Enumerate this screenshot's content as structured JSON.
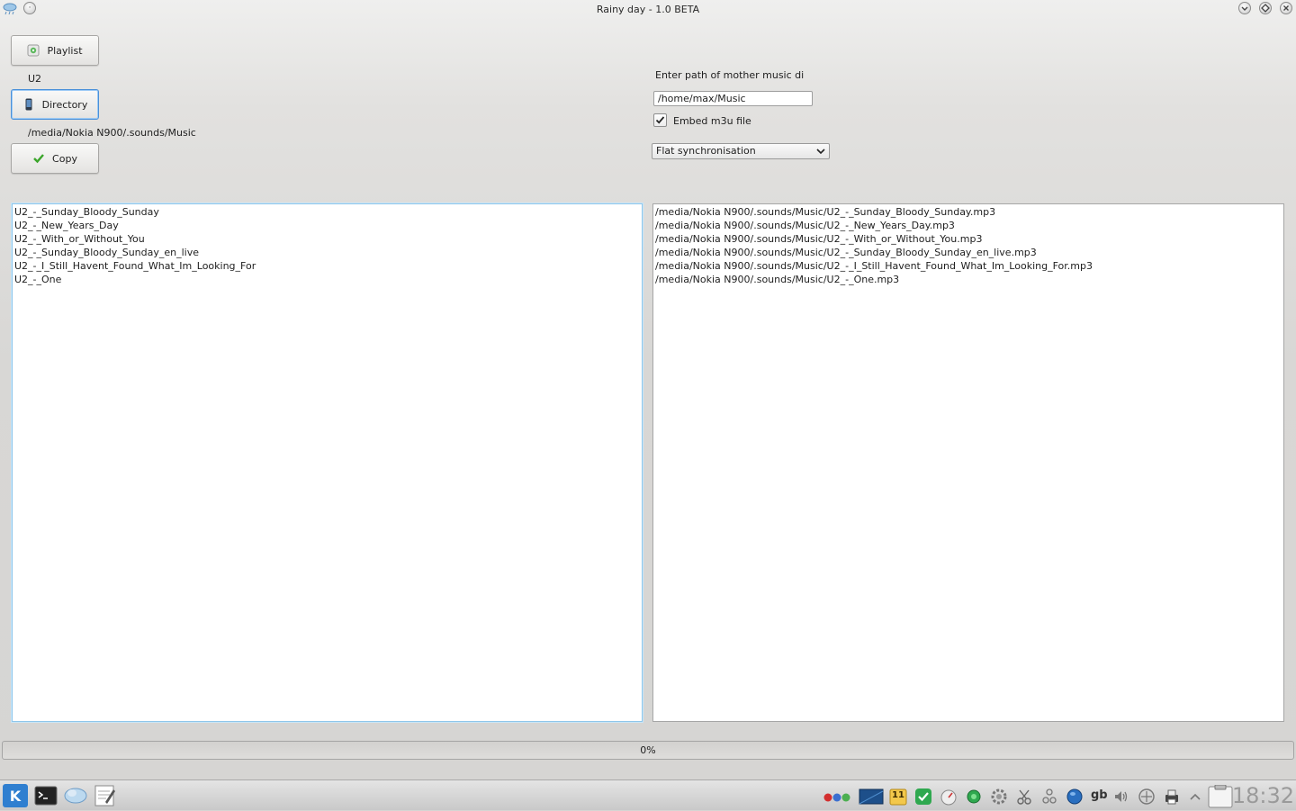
{
  "window": {
    "title": "Rainy day - 1.0 BETA"
  },
  "left_panel": {
    "playlist_button": "Playlist",
    "playlist_value": "U2",
    "directory_button": "Directory",
    "directory_value": "/media/Nokia N900/.sounds/Music",
    "copy_button": "Copy"
  },
  "right_panel": {
    "path_label": "Enter path of mother music di",
    "path_input_value": "/home/max/Music",
    "embed_checkbox_label": "Embed m3u file",
    "embed_checked": true,
    "sync_mode_selected": "Flat synchronisation"
  },
  "source_list": [
    "U2_-_Sunday_Bloody_Sunday",
    "U2_-_New_Years_Day",
    "U2_-_With_or_Without_You",
    "U2_-_Sunday_Bloody_Sunday_en_live",
    "U2_-_I_Still_Havent_Found_What_Im_Looking_For",
    "U2_-_One"
  ],
  "destination_list": [
    "/media/Nokia N900/.sounds/Music/U2_-_Sunday_Bloody_Sunday.mp3",
    "/media/Nokia N900/.sounds/Music/U2_-_New_Years_Day.mp3",
    "/media/Nokia N900/.sounds/Music/U2_-_With_or_Without_You.mp3",
    "/media/Nokia N900/.sounds/Music/U2_-_Sunday_Bloody_Sunday_en_live.mp3",
    "/media/Nokia N900/.sounds/Music/U2_-_I_Still_Havent_Found_What_Im_Looking_For.mp3",
    "/media/Nokia N900/.sounds/Music/U2_-_One.mp3"
  ],
  "progress": {
    "text": "0%",
    "value": 0
  },
  "taskbar": {
    "keyboard_layout": "gb",
    "clock": "18:32",
    "calendar_day": "11"
  },
  "colors": {
    "accent": "#4a90d9",
    "focus_border": "#8fc6ea",
    "check_green": "#3aa52a"
  }
}
